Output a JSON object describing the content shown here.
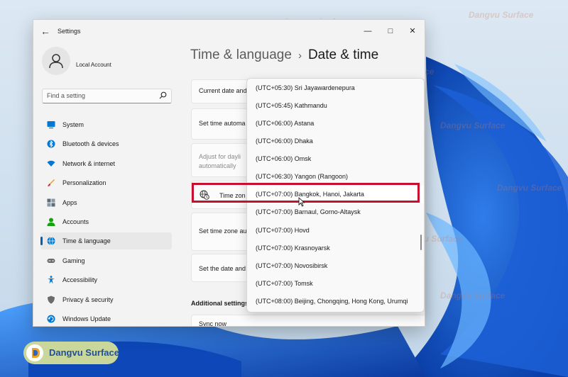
{
  "window": {
    "app_title": "Settings",
    "controls": {
      "minimize": "—",
      "maximize": "□",
      "close": "✕"
    }
  },
  "profile": {
    "account_name": "Local Account"
  },
  "search": {
    "placeholder": "Find a setting"
  },
  "sidebar": {
    "items": [
      {
        "label": "System",
        "icon": "monitor-icon",
        "color": "#0078d4"
      },
      {
        "label": "Bluetooth & devices",
        "icon": "bluetooth-icon",
        "color": "#0078d4"
      },
      {
        "label": "Network & internet",
        "icon": "wifi-icon",
        "color": "#0078d4"
      },
      {
        "label": "Personalization",
        "icon": "brush-icon",
        "color": "#e3a21a"
      },
      {
        "label": "Apps",
        "icon": "apps-icon",
        "color": "#5c6b7a"
      },
      {
        "label": "Accounts",
        "icon": "person-icon",
        "color": "#13a10e"
      },
      {
        "label": "Time & language",
        "icon": "globe-clock-icon",
        "color": "#0078d4",
        "active": true
      },
      {
        "label": "Gaming",
        "icon": "gamepad-icon",
        "color": "#6b6b6b"
      },
      {
        "label": "Accessibility",
        "icon": "accessibility-icon",
        "color": "#0078d4"
      },
      {
        "label": "Privacy & security",
        "icon": "shield-icon",
        "color": "#6b6b6b"
      },
      {
        "label": "Windows Update",
        "icon": "update-icon",
        "color": "#0078d4"
      }
    ]
  },
  "breadcrumb": {
    "parent": "Time & language",
    "separator": "›",
    "current": "Date & time"
  },
  "cards": {
    "current_date": "Current date and",
    "set_time_auto": "Set time automa",
    "adjust_daylight_line1": "Adjust for dayli",
    "adjust_daylight_line2": "automatically",
    "time_zone": "Time zon",
    "set_time_zone_auto": "Set time zone au",
    "set_date_time": "Set the date and"
  },
  "additional": {
    "title": "Additional settings",
    "sync_now": "Sync now"
  },
  "timezone_dropdown": {
    "options": [
      "(UTC+05:30) Sri Jayawardenepura",
      "(UTC+05:45) Kathmandu",
      "(UTC+06:00) Astana",
      "(UTC+06:00) Dhaka",
      "(UTC+06:00) Omsk",
      "(UTC+06:30) Yangon (Rangoon)",
      "(UTC+07:00) Bangkok, Hanoi, Jakarta",
      "(UTC+07:00) Barnaul, Gorno-Altaysk",
      "(UTC+07:00) Hovd",
      "(UTC+07:00) Krasnoyarsk",
      "(UTC+07:00) Novosibirsk",
      "(UTC+07:00) Tomsk",
      "(UTC+08:00) Beijing, Chongqing, Hong Kong, Urumqi"
    ],
    "selected": "(UTC+07:00) Bangkok, Hanoi, Jakarta"
  },
  "watermark": {
    "text": "Dangvu Surface"
  },
  "logo": {
    "text": "Dangvu Surface"
  },
  "colors": {
    "accent": "#005fb8",
    "highlight_box": "#c8102e",
    "logo_text": "#1f4e9b",
    "logo_bg": "#c9d89a"
  }
}
